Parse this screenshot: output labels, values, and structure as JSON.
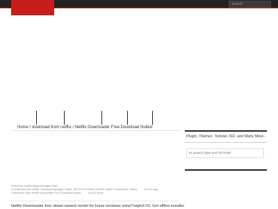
{
  "header": {
    "search_placeholder": "Search"
  },
  "breadcrumb": {
    "home": "Home",
    "separator": " / ",
    "category": "download from netflix",
    "current": "Netflix Downloader Free Download Nulled"
  },
  "sidebar": {
    "tagline": "Plugin, Themes, Tutorial, ISO, and Many More...",
    "search_placeholder": "to search type and hit enter"
  },
  "post": {
    "meta": {
      "posted_by": "Posted by: Nulled Mega Managed Team",
      "tags": "In download from netflix, Download Manager, Netflix, NETFLIX DOWNLOADER, Netflix Downloader, Others",
      "time_ago": "8 hours ago",
      "comments": "Comments Offon Netflix Downloader Free Download Nulled",
      "views": "13,020 Views"
    },
    "excerpt": "Netflix Downloader free obtain newest model for home windows vista/7/eight1/10. Get offline installer"
  },
  "colors": {
    "accent": "#c91d1d",
    "dark": "#222222"
  }
}
